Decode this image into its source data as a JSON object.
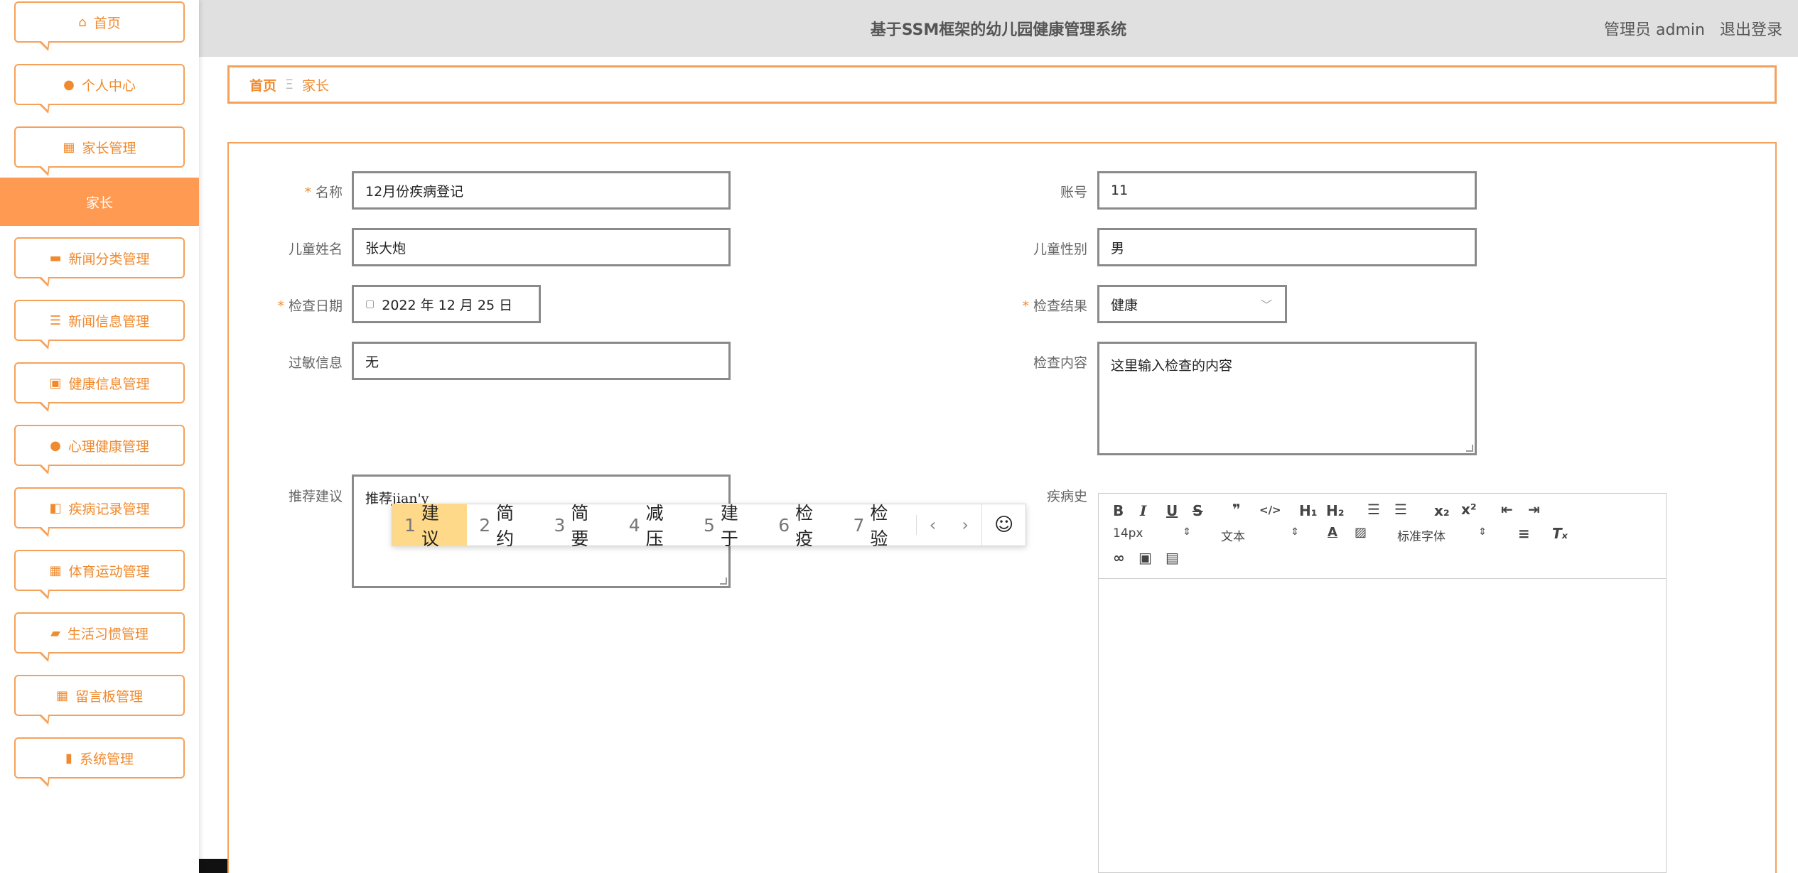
{
  "sidebar": {
    "items": [
      {
        "label": "首页",
        "icon": "home-icon"
      },
      {
        "label": "个人中心",
        "icon": "user-icon"
      },
      {
        "label": "家长管理",
        "icon": "grid-icon"
      },
      {
        "label": "新闻分类管理",
        "icon": "monitor-icon"
      },
      {
        "label": "新闻信息管理",
        "icon": "list-icon"
      },
      {
        "label": "健康信息管理",
        "icon": "clipboard-icon"
      },
      {
        "label": "心理健康管理",
        "icon": "balloon-icon"
      },
      {
        "label": "疾病记录管理",
        "icon": "hand-icon"
      },
      {
        "label": "体育运动管理",
        "icon": "table-icon"
      },
      {
        "label": "生活习惯管理",
        "icon": "ticket-icon"
      },
      {
        "label": "留言板管理",
        "icon": "grid-icon"
      },
      {
        "label": "系统管理",
        "icon": "chart-icon"
      }
    ],
    "active_sub": "家长"
  },
  "header": {
    "title": "基于SSM框架的幼儿园健康管理系统",
    "user": "管理员 admin",
    "logout": "退出登录"
  },
  "breadcrumb": {
    "home": "首页",
    "separator": "Ξ",
    "current": "家长"
  },
  "form": {
    "name_label": "名称",
    "name_value": "12月份疾病登记",
    "account_label": "账号",
    "account_value": "11",
    "child_name_label": "儿童姓名",
    "child_name_value": "张大炮",
    "child_gender_label": "儿童性别",
    "child_gender_value": "男",
    "check_date_label": "检查日期",
    "check_date_value": "2022 年 12 月 25 日",
    "check_result_label": "检查结果",
    "check_result_value": "健康",
    "allergy_label": "过敏信息",
    "allergy_value": "无",
    "check_content_label": "检查内容",
    "check_content_value": "这里输入检查的内容",
    "suggest_label": "推荐建议",
    "suggest_value": "推荐jian'y",
    "history_label": "疾病史"
  },
  "ime": {
    "candidates": [
      {
        "num": "1",
        "text": "建议"
      },
      {
        "num": "2",
        "text": "简约"
      },
      {
        "num": "3",
        "text": "简要"
      },
      {
        "num": "4",
        "text": "减压"
      },
      {
        "num": "5",
        "text": "建于"
      },
      {
        "num": "6",
        "text": "检疫"
      },
      {
        "num": "7",
        "text": "检验"
      }
    ],
    "prev": "‹",
    "next": "›",
    "emoji": "☺"
  },
  "editor": {
    "font_size": "14px",
    "text_type": "文本",
    "font_family": "标准字体",
    "bold": "B",
    "italic": "I",
    "underline": "U",
    "strike": "S",
    "quote": "❞",
    "code": "</>",
    "h1": "H₁",
    "h2": "H₂",
    "sub": "x₂",
    "sup": "x²",
    "clear": "Tₓ",
    "color_a": "A"
  },
  "colors": {
    "accent": "#f08a2e",
    "border_accent": "#f5a15a",
    "active_bg": "#ff9a52",
    "header_bg": "#e0e0e0"
  }
}
